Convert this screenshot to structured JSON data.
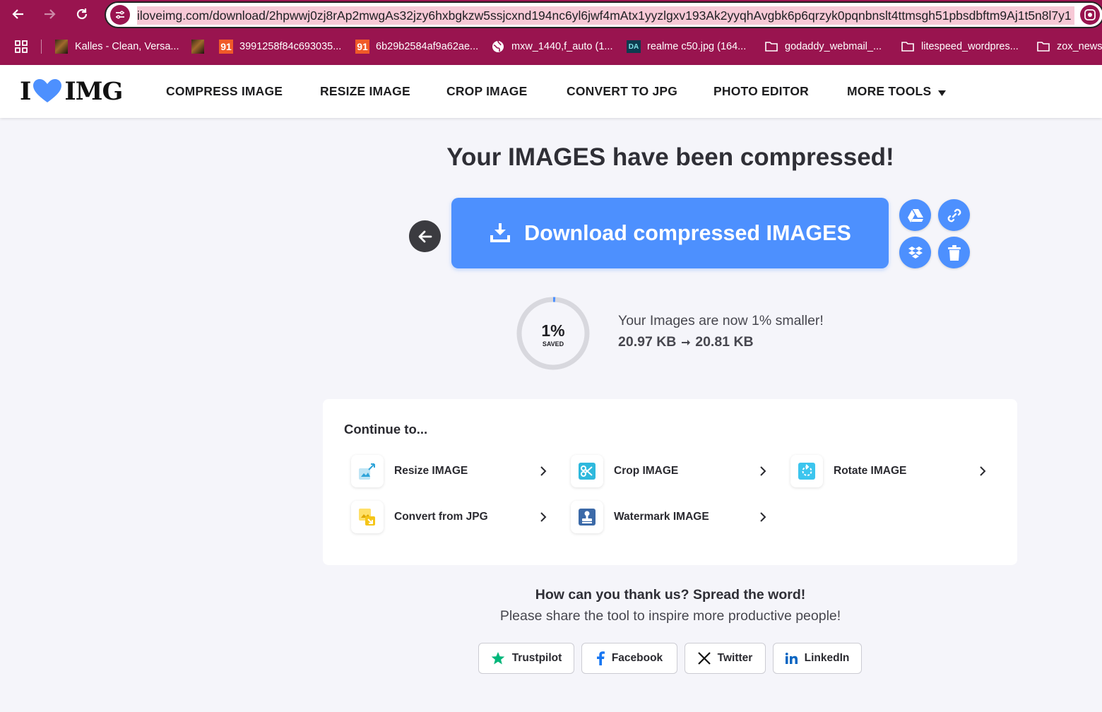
{
  "browser": {
    "url": "iloveimg.com/download/2hpwwj0zj8rAp2mwgAs32jzy6hxbgkzw5ssjcxnd194nc6yl6jwf4mAtx1yyzlgxv193Ak2yyqhAvgbk6p6qrzyk0pqnbnslt4ttmsgh51pbsdbftm9Aj1t5n8l7y1",
    "bookmarks": [
      {
        "label": "Kalles - Clean, Versa...",
        "icon": "thumbnail-icon"
      },
      {
        "label": "",
        "icon": "thumbnail-icon"
      },
      {
        "label": "3991258f84c693035...",
        "icon": "ninety-one-icon"
      },
      {
        "label": "6b29b2584af9a62ae...",
        "icon": "ninety-one-icon"
      },
      {
        "label": "mxw_1440,f_auto (1...",
        "icon": "globe-icon"
      },
      {
        "label": "realme c50.jpg (164...",
        "icon": "da-icon"
      },
      {
        "label": "godaddy_webmail_...",
        "icon": "folder-icon"
      },
      {
        "label": "litespeed_wordpres...",
        "icon": "folder-icon"
      },
      {
        "label": "zox_news",
        "icon": "folder-icon"
      }
    ],
    "favicon_91": "91",
    "favicon_da": "DA"
  },
  "site": {
    "logo_left": "I",
    "logo_right": "IMG",
    "logo_heart_color": "#4d90fe",
    "nav": [
      "COMPRESS IMAGE",
      "RESIZE IMAGE",
      "CROP IMAGE",
      "CONVERT TO JPG",
      "PHOTO EDITOR",
      "MORE TOOLS"
    ]
  },
  "main": {
    "title": "Your IMAGES have been compressed!",
    "download_label": "Download compressed IMAGES",
    "accent_color": "#4d90fe",
    "saved_percent": "1%",
    "saved_fraction": 0.01,
    "saved_label": "SAVED",
    "saved_message": "Your Images are now 1% smaller!",
    "size_before": "20.97 KB",
    "size_after": "20.81 KB"
  },
  "continue": {
    "title": "Continue to...",
    "tools": [
      {
        "label": "Resize IMAGE",
        "icon": "resize-icon"
      },
      {
        "label": "Crop IMAGE",
        "icon": "crop-icon"
      },
      {
        "label": "Rotate IMAGE",
        "icon": "rotate-icon"
      },
      {
        "label": "Convert from JPG",
        "icon": "convert-icon"
      },
      {
        "label": "Watermark IMAGE",
        "icon": "watermark-icon"
      }
    ]
  },
  "thanks": {
    "title": "How can you thank us? Spread the word!",
    "subtitle": "Please share the tool to inspire more productive people!",
    "share": [
      {
        "label": "Trustpilot",
        "icon": "trustpilot-star-icon",
        "color": "#00b67a"
      },
      {
        "label": "Facebook",
        "icon": "facebook-icon",
        "color": "#1877f2"
      },
      {
        "label": "Twitter",
        "icon": "x-twitter-icon",
        "color": "#111111"
      },
      {
        "label": "LinkedIn",
        "icon": "linkedin-icon",
        "color": "#0a66c2"
      }
    ]
  }
}
